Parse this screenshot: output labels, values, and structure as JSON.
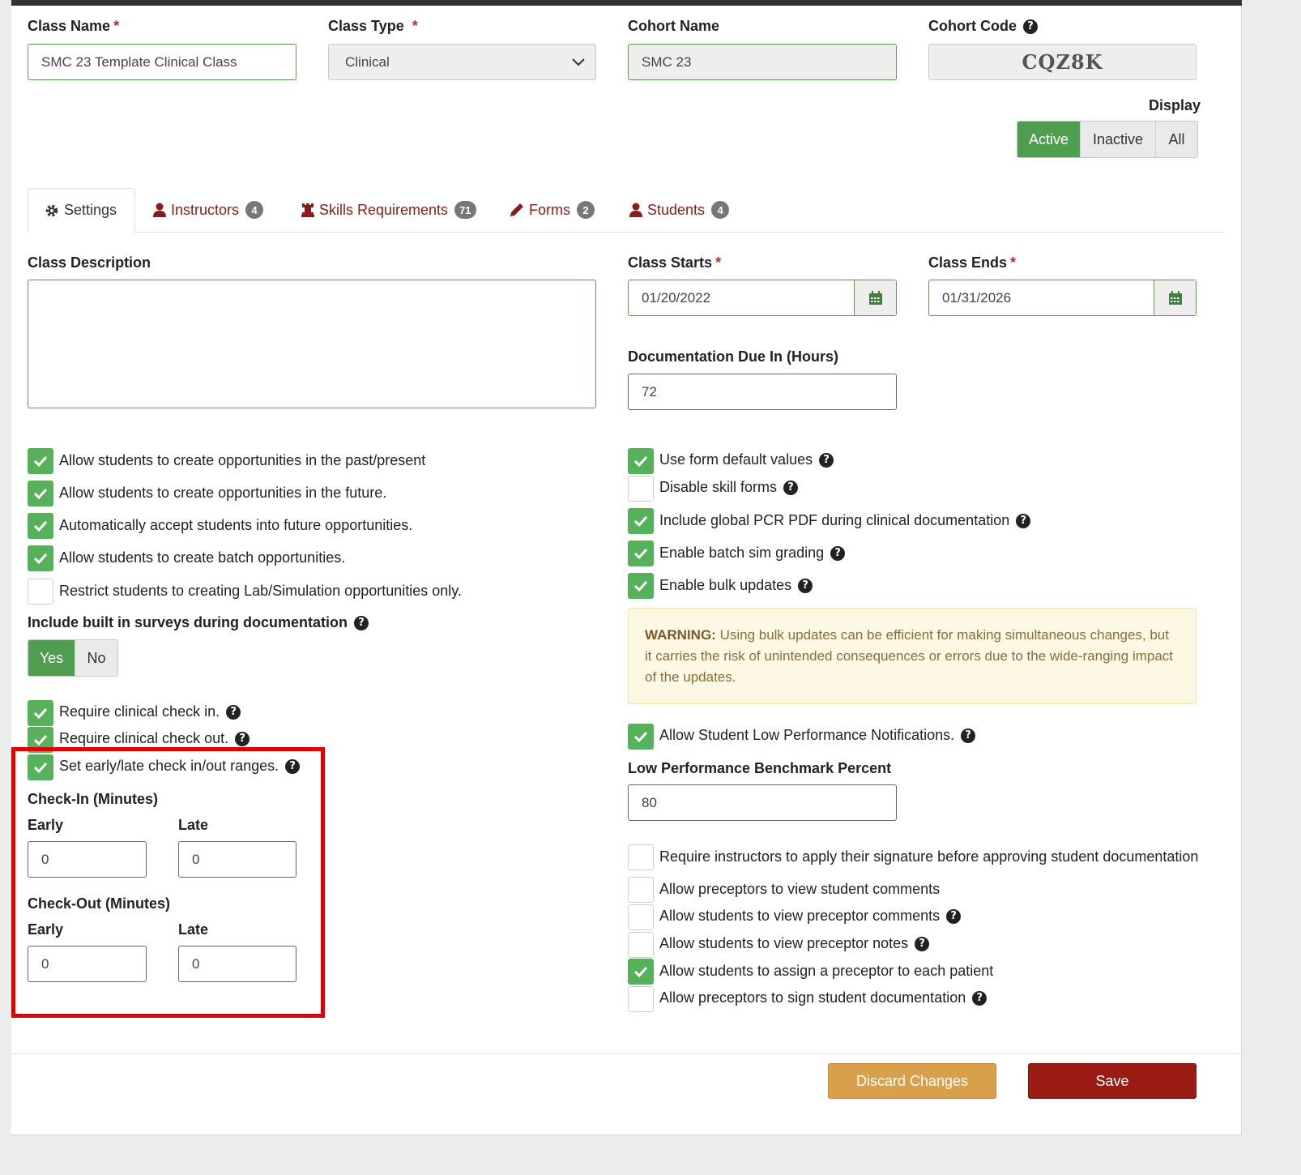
{
  "header": {
    "class_name_label": "Class Name",
    "class_name_value": "SMC 23 Template Clinical Class",
    "class_type_label": "Class Type",
    "class_type_value": "Clinical",
    "cohort_name_label": "Cohort Name",
    "cohort_name_value": "SMC 23",
    "cohort_code_label": "Cohort Code",
    "cohort_code_value": "CQZ8K",
    "required_marker": "*"
  },
  "display": {
    "label": "Display",
    "options": [
      "Active",
      "Inactive",
      "All"
    ],
    "selected": "Active"
  },
  "tabs": [
    {
      "label": "Settings",
      "badge": ""
    },
    {
      "label": "Instructors",
      "badge": "4"
    },
    {
      "label": "Skills Requirements",
      "badge": "71"
    },
    {
      "label": "Forms",
      "badge": "2"
    },
    {
      "label": "Students",
      "badge": "4"
    }
  ],
  "settings": {
    "description_label": "Class Description",
    "description_value": "",
    "class_starts_label": "Class Starts",
    "class_starts_value": "01/20/2022",
    "class_ends_label": "Class Ends",
    "class_ends_value": "01/31/2026",
    "doc_due_label": "Documentation Due In (Hours)",
    "doc_due_value": "72",
    "left_checks": [
      {
        "label": "Allow students to create opportunities in the past/present",
        "checked": true
      },
      {
        "label": "Allow students to create opportunities in the future.",
        "checked": true
      },
      {
        "label": "Automatically accept students into future opportunities.",
        "checked": true
      },
      {
        "label": "Allow students to create batch opportunities.",
        "checked": true
      },
      {
        "label": "Restrict students to creating Lab/Simulation opportunities only.",
        "checked": false
      }
    ],
    "surveys_label": "Include built in surveys during documentation",
    "surveys_options": [
      "Yes",
      "No"
    ],
    "surveys_selected": "Yes",
    "checkin_checks": [
      {
        "label": "Require clinical check in.",
        "checked": true
      },
      {
        "label": "Require clinical check out.",
        "checked": true
      },
      {
        "label": "Set early/late check in/out ranges.",
        "checked": true
      }
    ],
    "checkin_label": "Check-In (Minutes)",
    "checkout_label": "Check-Out (Minutes)",
    "early_label": "Early",
    "late_label": "Late",
    "checkin_early": "0",
    "checkin_late": "0",
    "checkout_early": "0",
    "checkout_late": "0",
    "right_checks": [
      {
        "label": "Use form default values",
        "checked": true
      },
      {
        "label": "Disable skill forms",
        "checked": false
      },
      {
        "label": "Include global PCR PDF during clinical documentation",
        "checked": true
      },
      {
        "label": "Enable batch sim grading",
        "checked": true
      },
      {
        "label": "Enable bulk updates",
        "checked": true
      }
    ],
    "warning_title": "WARNING:",
    "warning_text": "Using bulk updates can be efficient for making simultaneous changes, but it carries the risk of unintended consequences or errors due to the wide-ranging impact of the updates.",
    "low_perf_check": {
      "label": "Allow Student Low Performance Notifications.",
      "checked": true
    },
    "benchmark_label": "Low Performance Benchmark Percent",
    "benchmark_value": "80",
    "bottom_checks": [
      {
        "label": "Require instructors to apply their signature before approving student documentation",
        "checked": false
      },
      {
        "label": "Allow preceptors to view student comments",
        "checked": false
      },
      {
        "label": "Allow students to view preceptor comments",
        "checked": false
      },
      {
        "label": "Allow students to view preceptor notes",
        "checked": false
      },
      {
        "label": "Allow students to assign a preceptor to each patient",
        "checked": true
      },
      {
        "label": "Allow preceptors to sign student documentation",
        "checked": false
      }
    ]
  },
  "footer": {
    "discard_label": "Discard Changes",
    "save_label": "Save"
  },
  "colors": {
    "accent_green": "#57b05a",
    "tab_red": "#8b1a1a",
    "save_red": "#9b1c14",
    "discard_orange": "#d9a04b",
    "highlight_box": "#e00000"
  }
}
